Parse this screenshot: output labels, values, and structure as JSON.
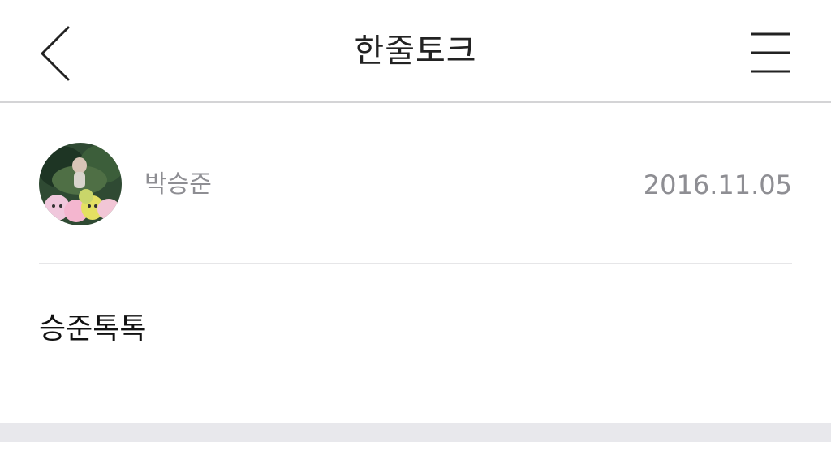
{
  "header": {
    "title": "한줄토크",
    "back_icon": "chevron-left-icon",
    "menu_icon": "hamburger-menu-icon"
  },
  "post": {
    "author": "박승준",
    "date": "2016.11.05",
    "body": "승준톡톡",
    "avatar_icon": "user-avatar-image"
  },
  "colors": {
    "title_text": "#222222",
    "meta_text": "#8e8e93",
    "body_text": "#111111",
    "divider": "#e6e6e8",
    "header_border": "#d4d4d6",
    "bottom_band": "#e8e8ec"
  }
}
